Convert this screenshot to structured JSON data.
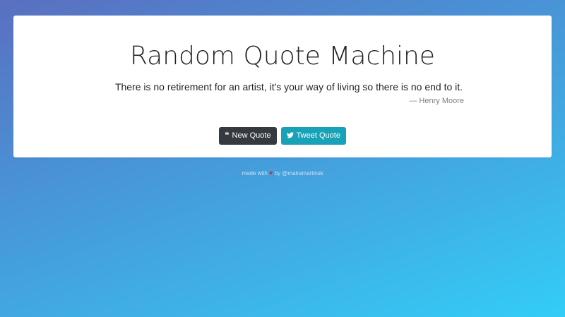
{
  "app": {
    "title": "Random Quote Machine"
  },
  "quote": {
    "text": "There is no retirement for an artist, it's your way of living so there is no end to it.",
    "author": "— Henry Moore"
  },
  "buttons": {
    "new_quote": "New Quote",
    "tweet_quote": "Tweet Quote",
    "new_quote_icon": "quote-left-icon",
    "tweet_icon": "twitter-icon"
  },
  "footer": {
    "prefix": "made with",
    "heart_icon": "heart-icon",
    "suffix": "by @mairamartinsk"
  },
  "colors": {
    "new_quote_button": "#343a40",
    "tweet_button": "#17a2b8",
    "heart": "#c0392b"
  }
}
